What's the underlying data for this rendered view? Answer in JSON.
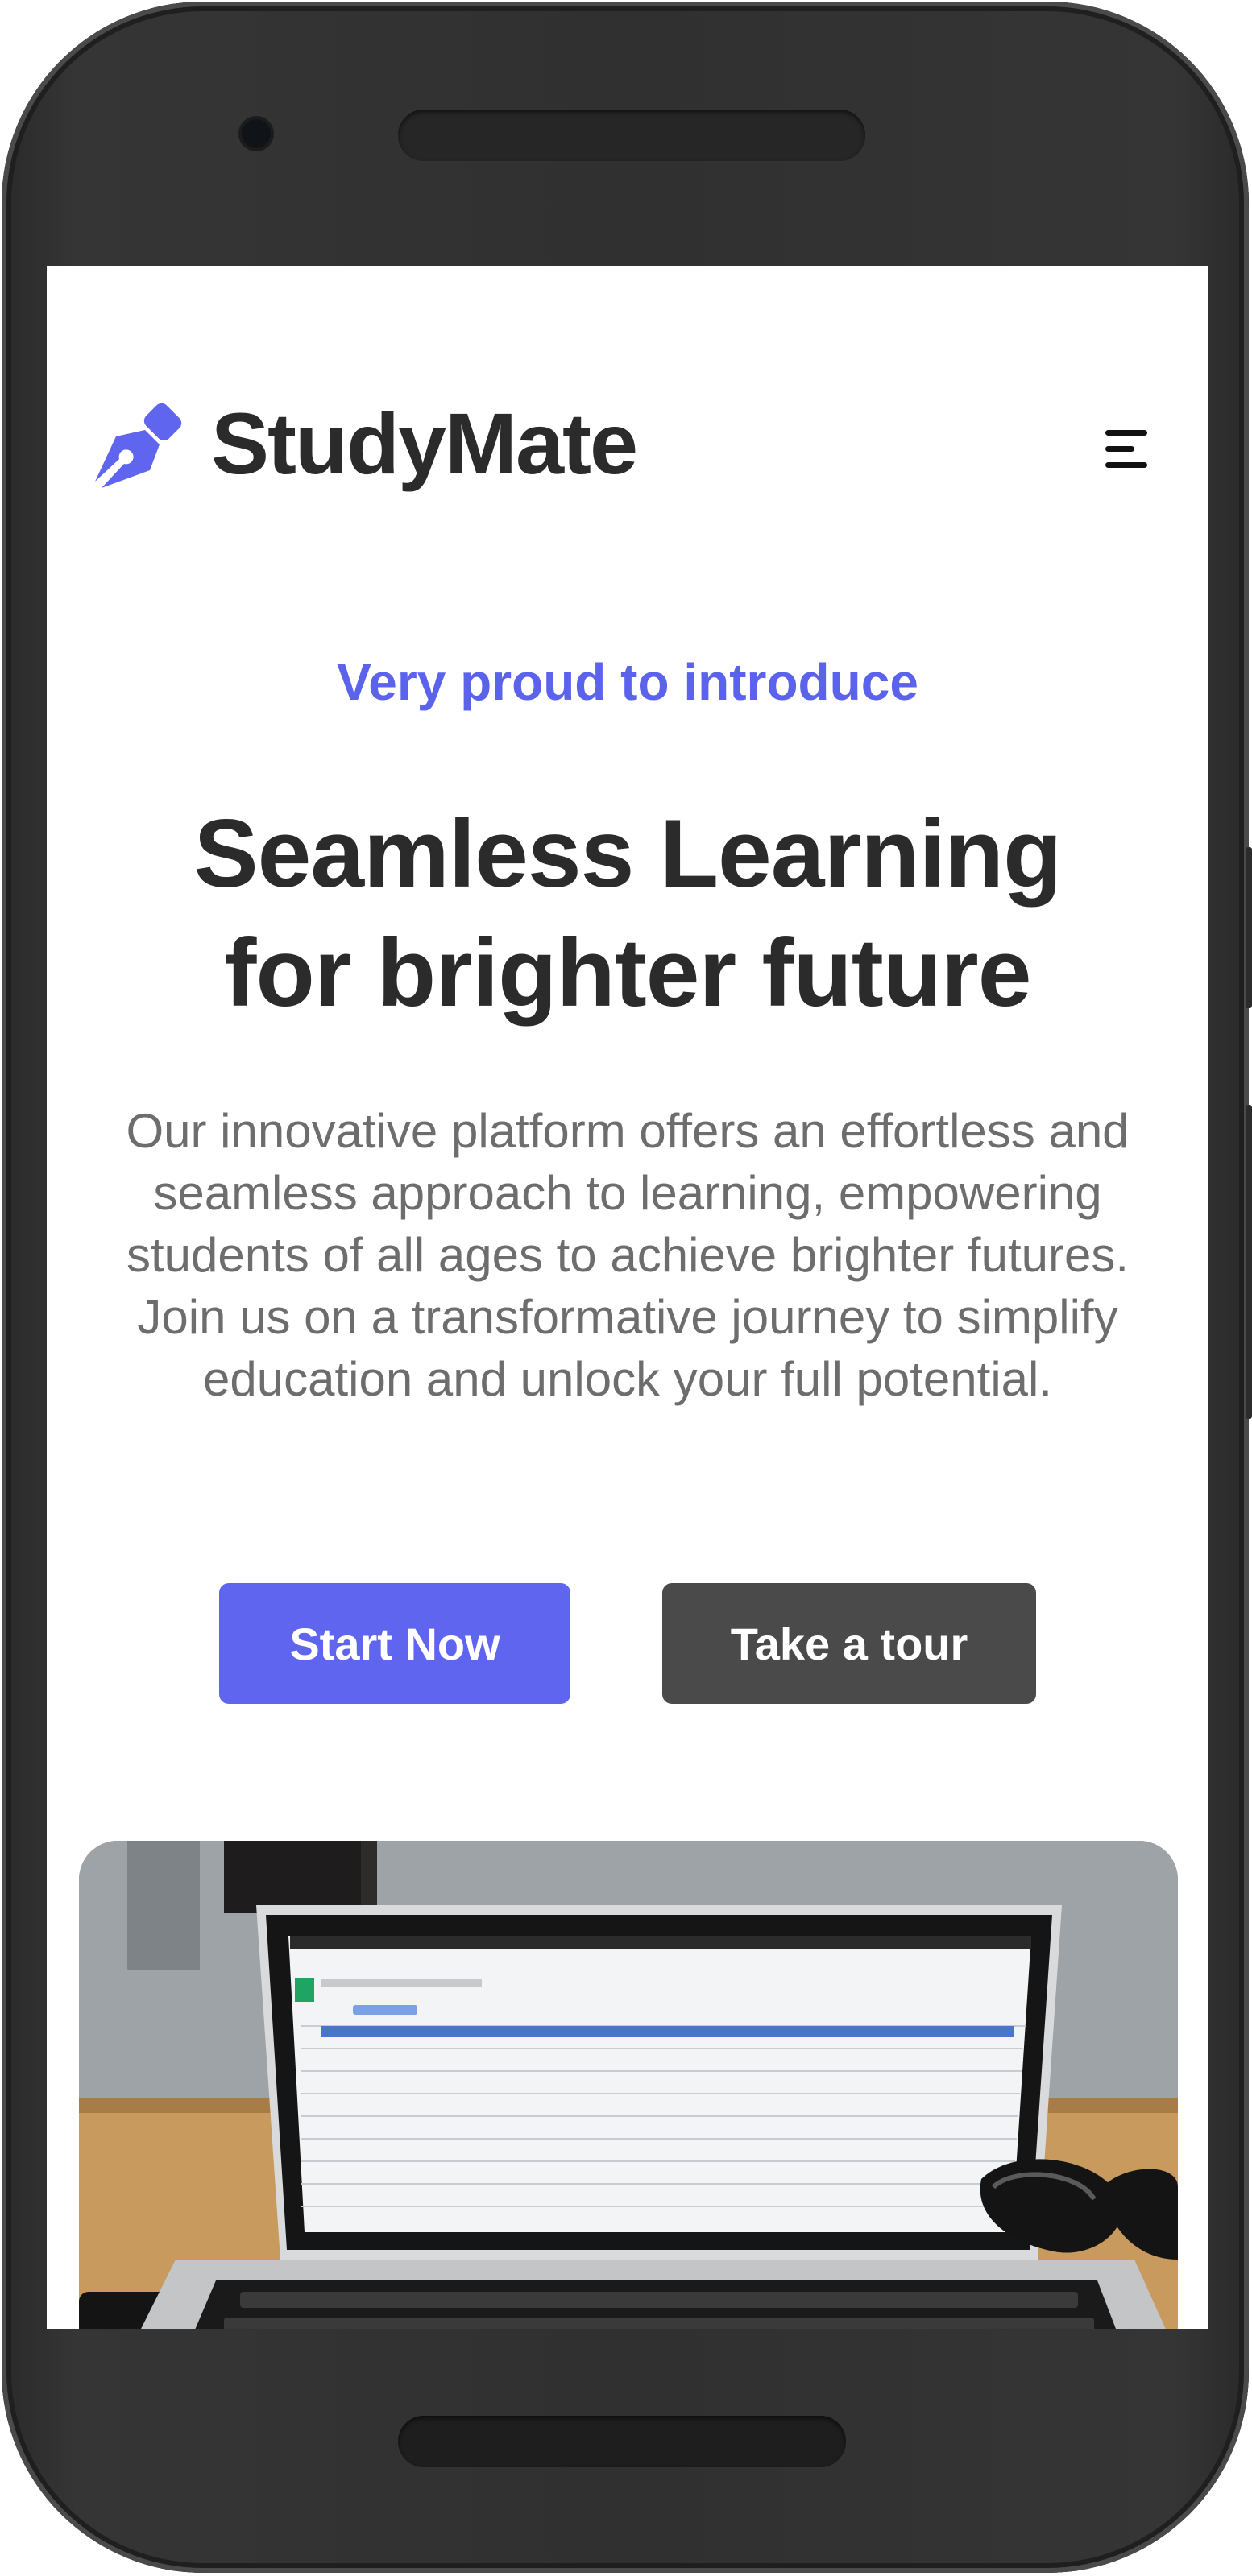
{
  "app": {
    "brand_name": "StudyMate",
    "logo_icon": "pen-nib-icon",
    "menu_icon": "hamburger-menu-icon"
  },
  "hero": {
    "eyebrow": "Very proud to introduce",
    "headline_line1": "Seamless Learning",
    "headline_line2": "for brighter future",
    "lead": "Our innovative platform offers an effortless and seamless approach to learning, empowering students of all ages to achieve brighter futures. Join us on a transformative journey to simplify education and unlock your full potential.",
    "primary_button": "Start Now",
    "secondary_button": "Take a tour",
    "image_subject": "laptop showing a spreadsheet on a wooden desk with sunglasses"
  },
  "colors": {
    "accent": "#5f65ef",
    "eyebrow": "#5b62ec",
    "heading": "#2b2b2b",
    "body_text": "#6d6d6d",
    "secondary_button": "#4a4a4a",
    "device_frame": "#303030"
  }
}
